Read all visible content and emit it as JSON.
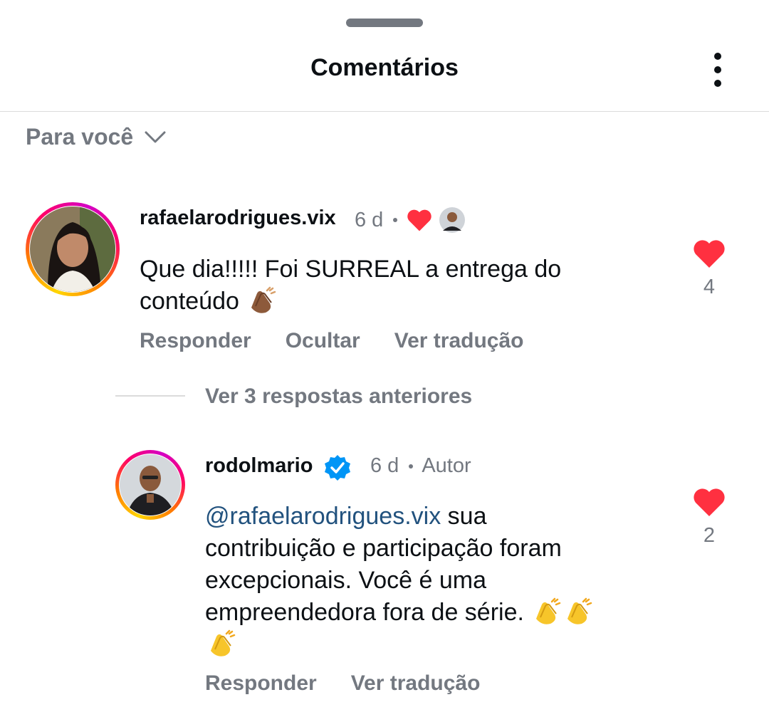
{
  "header": {
    "title": "Comentários"
  },
  "filter": {
    "label": "Para você"
  },
  "comments": [
    {
      "username": "rafaelarodrigues.vix",
      "time": "6 d",
      "text_line1": "Que dia!!!!! Foi SURREAL a entrega do",
      "text_line2": "conteúdo",
      "likes": "4",
      "actions": {
        "reply": "Responder",
        "hide": "Ocultar",
        "translate": "Ver tradução"
      }
    }
  ],
  "replies_toggle": {
    "label": "Ver 3 respostas anteriores"
  },
  "reply": {
    "username": "rodolmario",
    "time": "6 d",
    "author_badge": "Autor",
    "mention": "@rafaelarodrigues.vix",
    "text_line1_rest": " sua",
    "text_line2": "contribuição e participação foram",
    "text_line3": "excepcionais.  Você é uma",
    "text_line4": "empreendedora fora de série.",
    "likes": "2",
    "actions": {
      "reply": "Responder",
      "translate": "Ver tradução"
    }
  },
  "colors": {
    "heart": "#ff3040",
    "verified": "#0095f6",
    "secondary_text": "#737880",
    "mention": "#22527e"
  },
  "icons": [
    "more-vertical-icon",
    "chevron-down-icon",
    "heart-icon",
    "verified-badge-icon",
    "clapping-hands-emoji"
  ]
}
